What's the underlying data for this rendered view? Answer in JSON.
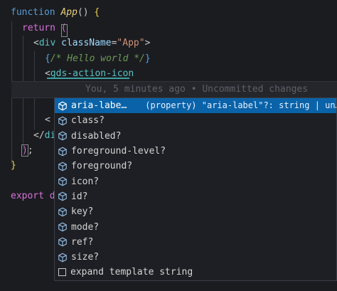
{
  "code": {
    "line1": {
      "kw": "function",
      "name": "App",
      "rest": "()",
      "brace": "{"
    },
    "line2": {
      "kw": "return",
      "paren": "("
    },
    "line3": {
      "open": "<",
      "tag": "div",
      "attr": "className",
      "eq": "=",
      "val": "\"App\"",
      "close": ">"
    },
    "line4": {
      "brace_open": "{",
      "comment": "/* Hello world */",
      "brace_close": "}"
    },
    "line5": {
      "open": "<",
      "tag": "gds-action-icon"
    },
    "line7": {
      "frag": "<"
    },
    "line8": {
      "frag": "</"
    },
    "line9": {
      "paren": ")",
      "semi": ";"
    },
    "line10": {
      "brace": "}"
    },
    "line12": {
      "kw": "export",
      "frag": "d"
    }
  },
  "ghost_text": "You, 5 minutes ago • Uncommitted changes",
  "suggestions": [
    {
      "label": "aria-labe…",
      "detail": "(property) \"aria-label\"?: string | un…",
      "selected": true
    },
    {
      "label": "class?"
    },
    {
      "label": "disabled?"
    },
    {
      "label": "foreground-level?"
    },
    {
      "label": "foreground?"
    },
    {
      "label": "icon?"
    },
    {
      "label": "id?"
    },
    {
      "label": "key?"
    },
    {
      "label": "mode?"
    },
    {
      "label": "ref?"
    },
    {
      "label": "size?"
    }
  ],
  "template_item": {
    "label": "expand template string"
  },
  "colors": {
    "background": "#1b1c20",
    "selection": "#0a63a8",
    "keyword": "#d971d9",
    "tag": "#58c4c4"
  },
  "icons": {
    "suggestion": "cube-icon",
    "template": "square-icon"
  }
}
